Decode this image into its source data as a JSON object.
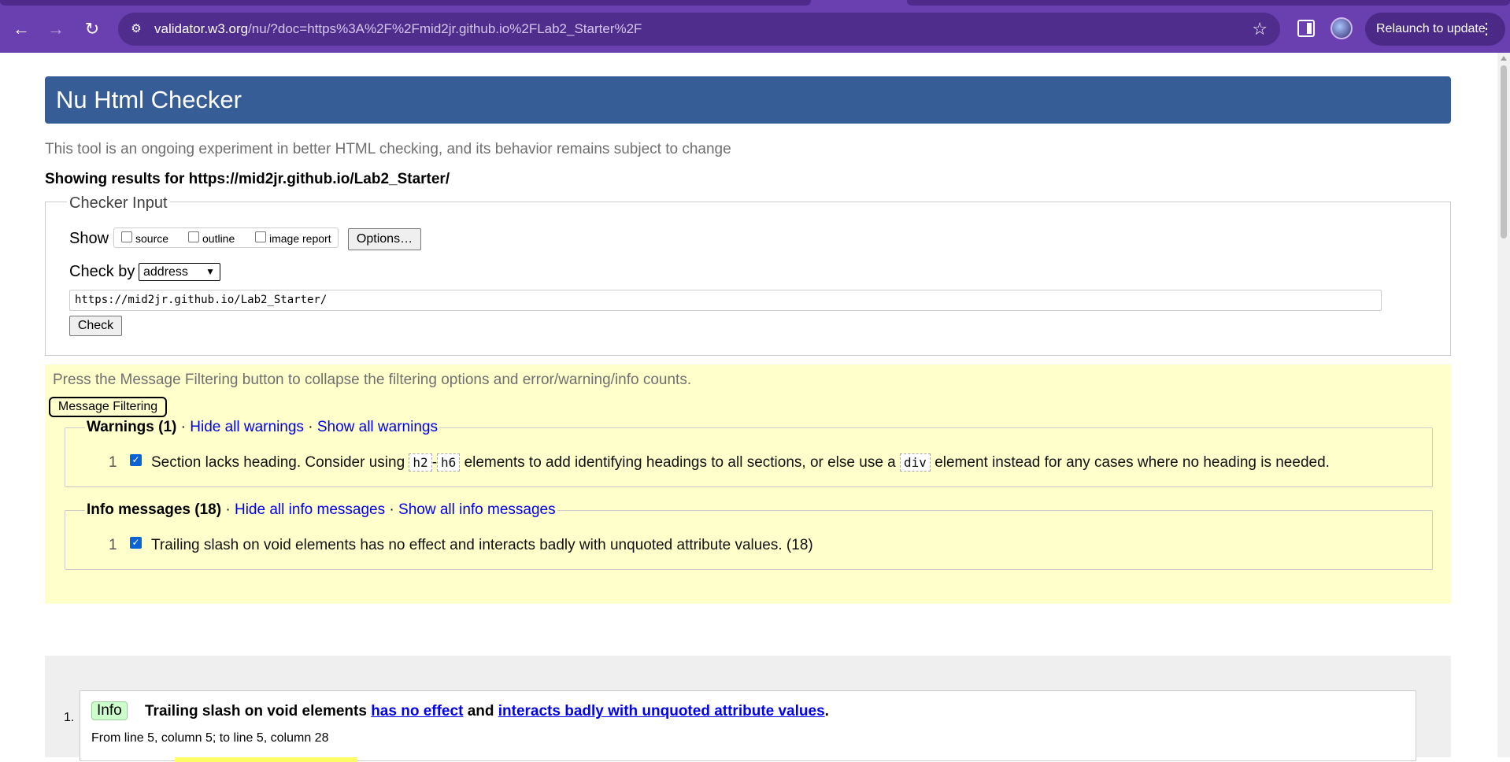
{
  "browser": {
    "url_host": "validator.w3.org",
    "url_path": "/nu/?doc=https%3A%2F%2Fmid2jr.github.io%2FLab2_Starter%2F",
    "relaunch_label": "Relaunch to update"
  },
  "header": {
    "title": "Nu Html Checker"
  },
  "intro": "This tool is an ongoing experiment in better HTML checking, and its behavior remains subject to change",
  "showing": "Showing results for https://mid2jr.github.io/Lab2_Starter/",
  "checker": {
    "legend": "Checker Input",
    "show_label": "Show",
    "checkboxes": [
      "source",
      "outline",
      "image report"
    ],
    "options_label": "Options…",
    "check_by_label": "Check by",
    "check_by_value": "address",
    "url_value": "https://mid2jr.github.io/Lab2_Starter/",
    "check_button": "Check"
  },
  "filtering": {
    "text": "Press the Message Filtering button to collapse the filtering options and error/warning/info counts.",
    "button": "Message Filtering",
    "warnings": {
      "title": "Warnings (1)",
      "sep": "·",
      "hide": "Hide all warnings",
      "show": "Show all warnings",
      "count": "1",
      "msg_pre": "Section lacks heading. Consider using",
      "code1": "h2",
      "dash": "-",
      "code2": "h6",
      "msg_mid": "elements to add identifying headings to all sections, or else use a",
      "code3": "div",
      "msg_post": "element instead for any cases where no heading is needed."
    },
    "info": {
      "title": "Info messages (18)",
      "sep": "·",
      "hide": "Hide all info messages",
      "show": "Show all info messages",
      "count": "1",
      "msg": "Trailing slash on void elements has no effect and interacts badly with unquoted attribute values. (18)"
    }
  },
  "results": {
    "number": "1.",
    "badge": "Info",
    "title_pre": "Trailing slash on void elements",
    "link1": "has no effect",
    "and": "and",
    "link2": "interacts badly with unquoted attribute values",
    "period": ".",
    "location": "From line 5, column 5; to line 5, column 28"
  }
}
